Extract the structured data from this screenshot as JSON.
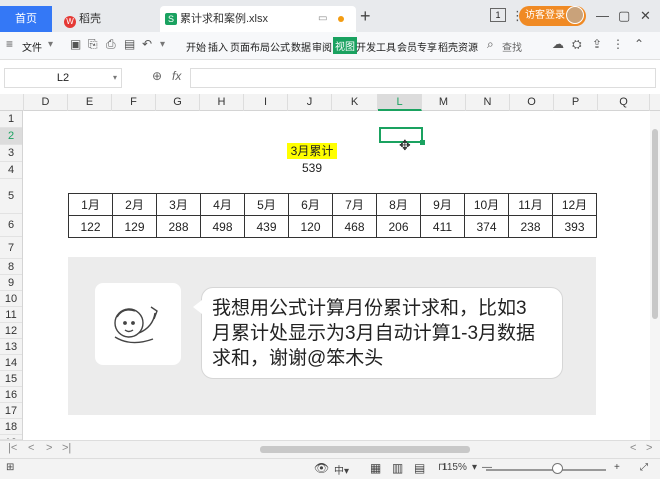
{
  "titlebar": {
    "home_tab": "首页",
    "doc_tab": "稻壳",
    "file_tab": "累计求和案例.xlsx",
    "badge_num": "1",
    "login": "访客登录"
  },
  "ribbon": {
    "file": "文件",
    "menus": [
      "开始",
      "插入",
      "页面布局",
      "公式",
      "数据",
      "审阅",
      "视图",
      "开发工具",
      "会员专享",
      "稻壳资源"
    ],
    "active_index": 6,
    "search": "查找"
  },
  "formula": {
    "name_box": "L2",
    "fx": "fx"
  },
  "columns": [
    "D",
    "E",
    "F",
    "G",
    "H",
    "I",
    "J",
    "K",
    "L",
    "M",
    "N",
    "O",
    "P",
    "Q"
  ],
  "selected_column": "L",
  "rows": [
    "1",
    "2",
    "3",
    "4",
    "5",
    "6",
    "7",
    "8",
    "9",
    "10",
    "11",
    "12",
    "13",
    "14",
    "15",
    "16",
    "17",
    "18",
    "19"
  ],
  "selected_row": "2",
  "sheet": {
    "label": "3月累计",
    "value": "539",
    "months": [
      "1月",
      "2月",
      "3月",
      "4月",
      "5月",
      "6月",
      "7月",
      "8月",
      "9月",
      "10月",
      "11月",
      "12月"
    ],
    "values": [
      "122",
      "129",
      "288",
      "498",
      "439",
      "120",
      "468",
      "206",
      "411",
      "374",
      "238",
      "393"
    ]
  },
  "chat": {
    "line1": "我想用公式计算月份累计求和，比如3",
    "line2": "月累计处显示为3月自动计算1-3月数据",
    "line3": "求和，谢谢@笨木头"
  },
  "status": {
    "zoom": "115%"
  },
  "colors": {
    "accent": "#1aa260",
    "home": "#3478f6",
    "login": "#f08a24",
    "highlight": "#ffff00"
  }
}
